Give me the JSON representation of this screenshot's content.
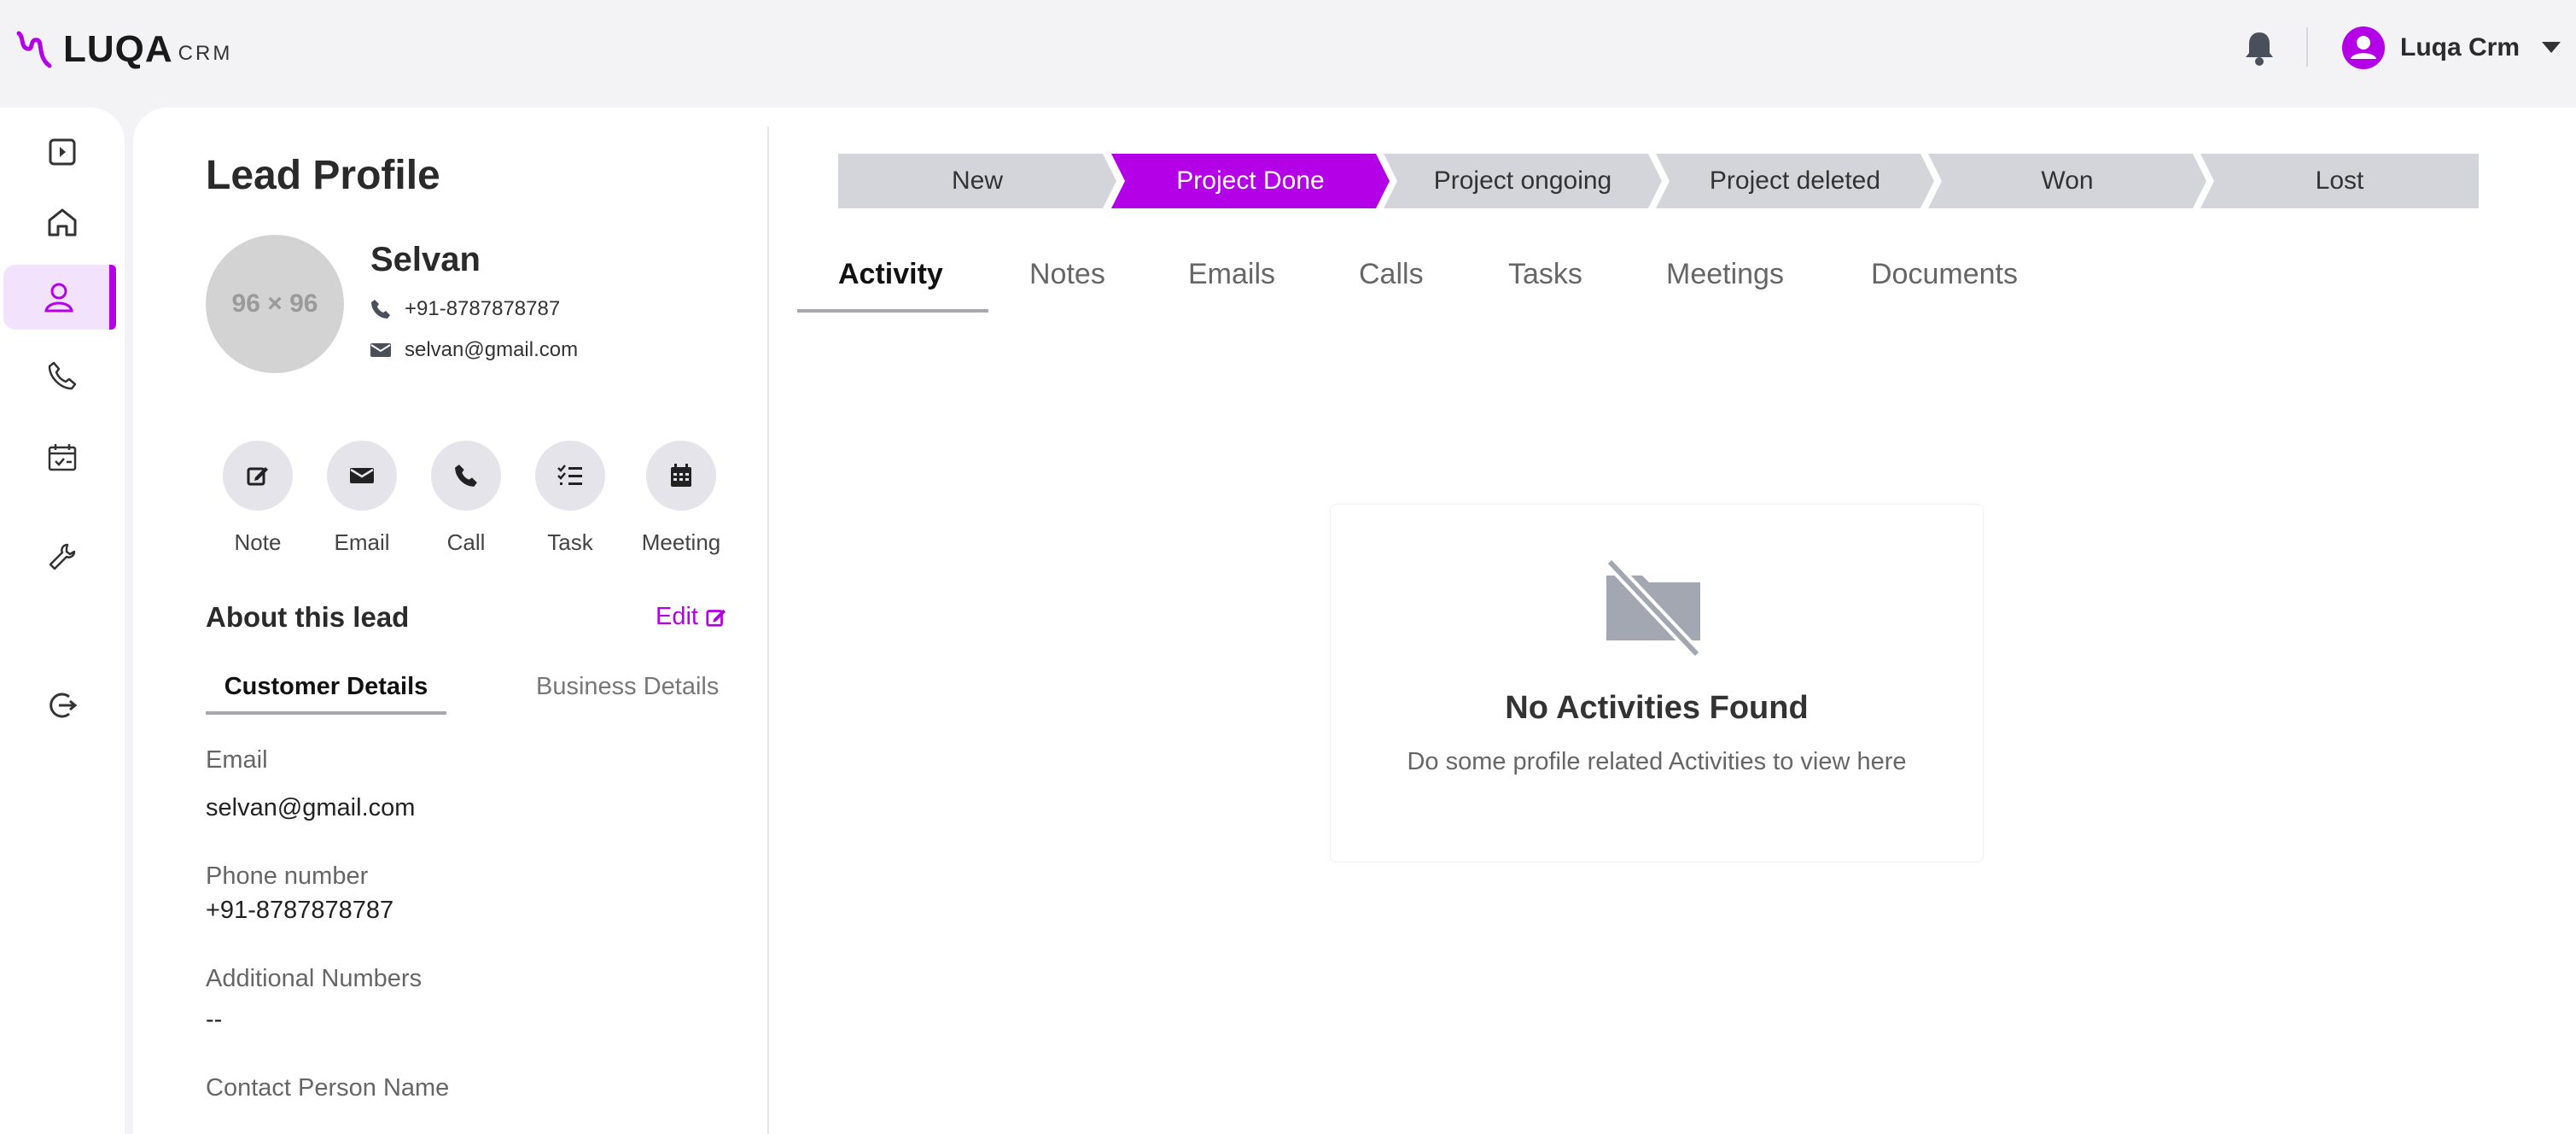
{
  "brand": {
    "name": "LUQA",
    "sub": "CRM"
  },
  "header": {
    "user_name": "Luqa Crm"
  },
  "sidebar": {
    "items": [
      {
        "icon": "toggle-sidebar-icon"
      },
      {
        "icon": "home-icon"
      },
      {
        "icon": "leads-icon",
        "active": true
      },
      {
        "icon": "phone-icon"
      },
      {
        "icon": "calendar-check-icon"
      },
      {
        "icon": "wrench-icon"
      },
      {
        "icon": "logout-icon"
      }
    ]
  },
  "profile": {
    "title": "Lead Profile",
    "avatar_placeholder": "96 × 96",
    "name": "Selvan",
    "phone": "+91-8787878787",
    "email": "selvan@gmail.com",
    "actions": [
      "Note",
      "Email",
      "Call",
      "Task",
      "Meeting"
    ],
    "about_title": "About this lead",
    "edit_label": "Edit",
    "sub_tabs": [
      "Customer Details",
      "Business Details"
    ],
    "fields": [
      {
        "label": "Email",
        "value": "selvan@gmail.com"
      },
      {
        "label": "Phone number",
        "value": "+91-8787878787"
      },
      {
        "label": "Additional Numbers",
        "value": "--"
      },
      {
        "label": "Contact Person Name",
        "value": ""
      }
    ]
  },
  "pipeline": {
    "stages": [
      "New",
      "Project Done",
      "Project ongoing",
      "Project deleted",
      "Won",
      "Lost"
    ],
    "active_index": 1
  },
  "tabs": [
    "Activity",
    "Notes",
    "Emails",
    "Calls",
    "Tasks",
    "Meetings",
    "Documents"
  ],
  "empty_state": {
    "title": "No Activities Found",
    "subtitle": "Do some profile related Activities to view here"
  },
  "colors": {
    "accent": "#b400e6",
    "stage_bg": "#d4d5db"
  }
}
